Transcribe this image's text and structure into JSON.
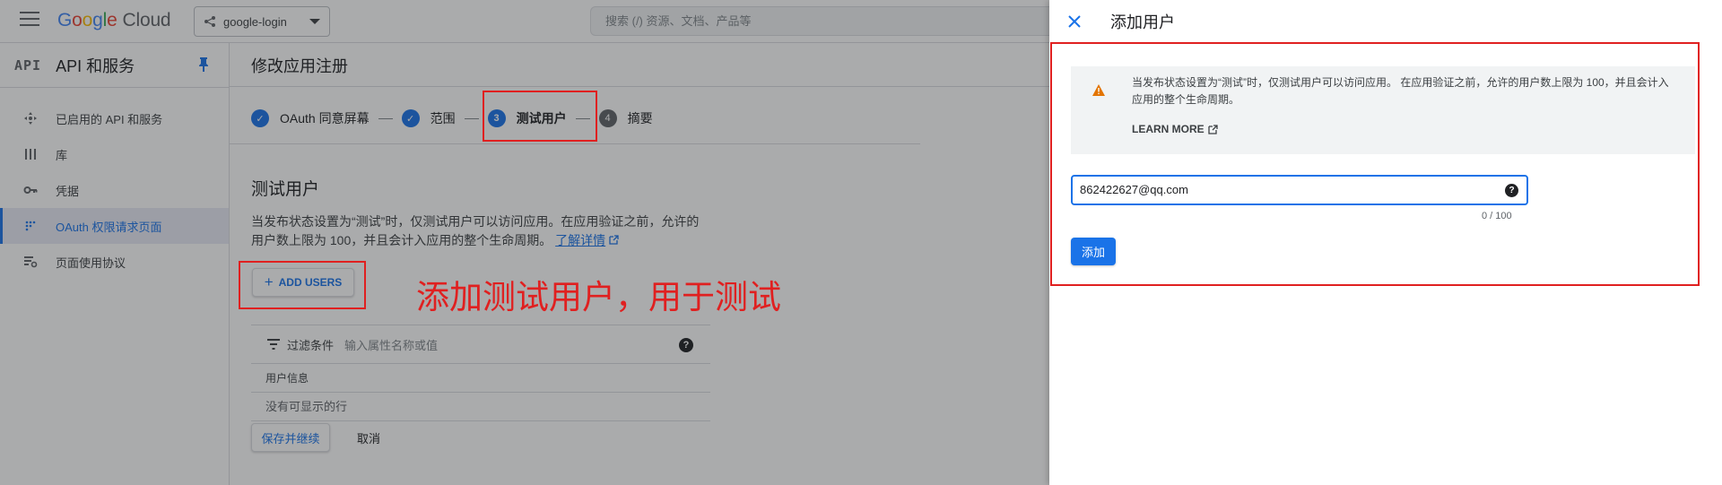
{
  "topbar": {
    "logo_google": "Google",
    "logo_cloud": "Cloud",
    "project": "google-login",
    "search_placeholder": "搜索 (/) 资源、文档、产品等"
  },
  "sidebar": {
    "badge": "API",
    "title": "API 和服务",
    "items": [
      {
        "label": "已启用的 API 和服务",
        "icon": "api-hub-icon"
      },
      {
        "label": "库",
        "icon": "library-icon"
      },
      {
        "label": "凭据",
        "icon": "key-icon"
      },
      {
        "label": "OAuth 权限请求页面",
        "icon": "oauth-consent-icon"
      },
      {
        "label": "页面使用协议",
        "icon": "page-usage-icon"
      }
    ]
  },
  "main": {
    "page_title": "修改应用注册",
    "steps": [
      {
        "num": "✓",
        "label": "OAuth 同意屏幕",
        "state": "done"
      },
      {
        "num": "✓",
        "label": "范围",
        "state": "done"
      },
      {
        "num": "3",
        "label": "测试用户",
        "state": "current"
      },
      {
        "num": "4",
        "label": "摘要",
        "state": "todo"
      }
    ],
    "section_title": "测试用户",
    "description": "当发布状态设置为“测试”时，仅测试用户可以访问应用。在应用验证之前，允许的用户数上限为 100，并且会计入应用的整个生命周期。",
    "learn_more_link": "了解详情",
    "add_users_label": "ADD USERS",
    "annotation": "添加测试用户，用于测试",
    "filter_label": "过滤条件",
    "filter_placeholder": "输入属性名称或值",
    "table_header": "用户信息",
    "table_empty": "没有可显示的行",
    "save_label": "保存并继续",
    "cancel_label": "取消"
  },
  "panel": {
    "title": "添加用户",
    "alert_text": "当发布状态设置为“测试”时，仅测试用户可以访问应用。 在应用验证之前，允许的用户数上限为 100，并且会计入应用的整个生命周期。",
    "learn_more": "LEARN MORE",
    "email_value": "862422627@qq.com",
    "counter": "0 / 100",
    "add_label": "添加"
  },
  "colors": {
    "accent": "#1a73e8",
    "annotation_red": "#e02020",
    "warning": "#e37400"
  }
}
